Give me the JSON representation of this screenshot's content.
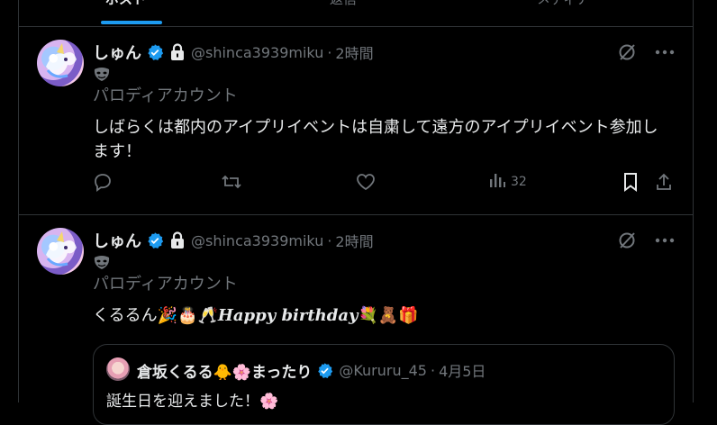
{
  "tabs": [
    {
      "label": "ポスト",
      "active": true
    },
    {
      "label": "返信",
      "active": false
    },
    {
      "label": "メディア",
      "active": false
    }
  ],
  "tweets": [
    {
      "display_name": "しゅん",
      "handle": "@shinca3939miku",
      "separator": "·",
      "time": "2時間",
      "badge": "パロディアカウント",
      "text": "しばらくは都内のアイプリイベントは自粛して遠方のアイプリイベント参加します！",
      "views": "32"
    },
    {
      "display_name": "しゅん",
      "handle": "@shinca3939miku",
      "separator": "·",
      "time": "2時間",
      "badge": "パロディアカウント",
      "text_prefix": "くるるん",
      "text_emoji1": "🎉🎂🥂",
      "text_italic": "Happy birthday",
      "text_emoji2": "💐🧸🎁",
      "quote": {
        "name": "倉坂くるる🐥🌸まったり",
        "handle": "@Kururu_45",
        "separator": "·",
        "date": "4月5日",
        "text": "誕生日を迎えました！🌸"
      }
    }
  ],
  "colors": {
    "accent": "#1d9bf0",
    "muted": "#71767b",
    "text": "#e7e9ea",
    "border": "#2f3336"
  }
}
